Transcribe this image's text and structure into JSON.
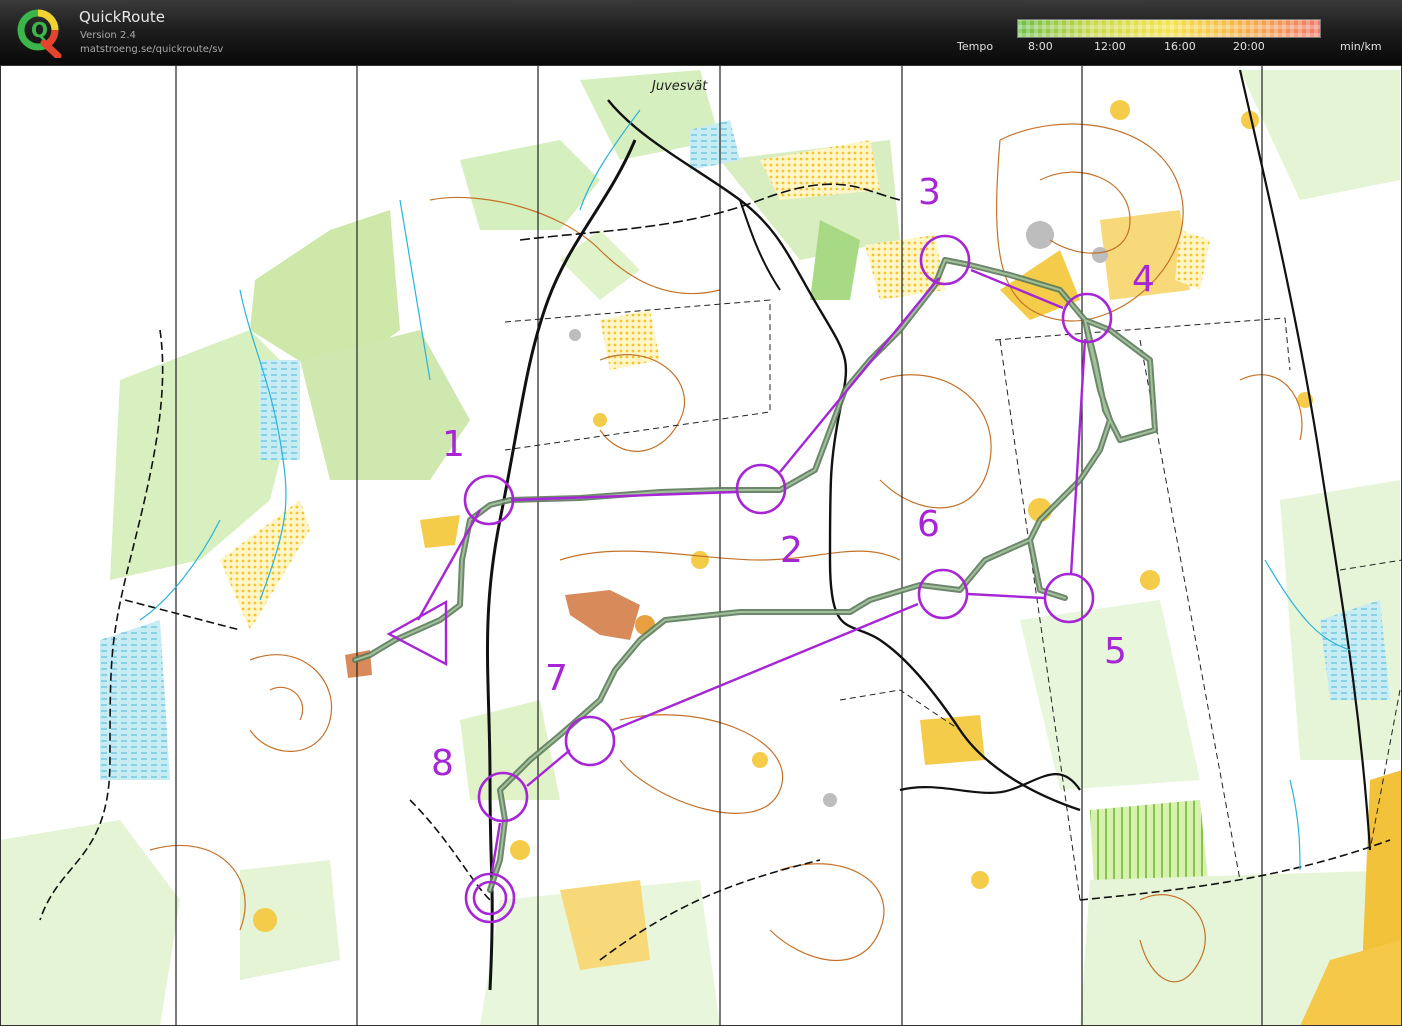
{
  "header": {
    "title": "QuickRoute",
    "version": "Version 2.4",
    "url": "matstroeng.se/quickroute/sv",
    "logo_letter": "Q"
  },
  "legend": {
    "label": "Tempo",
    "ticks": [
      "8:00",
      "12:00",
      "16:00",
      "20:00"
    ],
    "unit": "min/km",
    "colors": [
      "#6fbf4a",
      "#c8d84a",
      "#f4e34a",
      "#f5b04a",
      "#f07a6a"
    ]
  },
  "map": {
    "place_name": "Juvesvät",
    "controls": [
      "1",
      "2",
      "3",
      "4",
      "5",
      "6",
      "7",
      "8"
    ],
    "course_color": "#a626d6",
    "route_color": "#6f8a6f"
  }
}
